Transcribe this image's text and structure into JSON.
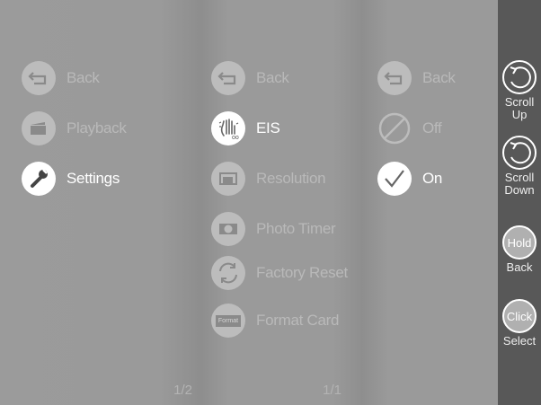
{
  "panel1": {
    "items": [
      {
        "label": "Back",
        "icon": "back-arrow-icon",
        "active": false
      },
      {
        "label": "Playback",
        "icon": "playback-icon",
        "active": false
      },
      {
        "label": "Settings",
        "icon": "wrench-icon",
        "active": true
      }
    ],
    "pager": "1/2"
  },
  "panel2": {
    "items": [
      {
        "label": "Back",
        "icon": "back-arrow-icon",
        "active": false
      },
      {
        "label": "EIS",
        "icon": "shaking-hand-icon",
        "active": true
      },
      {
        "label": "Resolution",
        "icon": "resolution-icon",
        "active": false
      },
      {
        "label": "Photo Timer",
        "icon": "photo-timer-icon",
        "active": false
      },
      {
        "label": "Factory Reset",
        "icon": "factory-reset-icon",
        "active": false
      },
      {
        "label": "Format Card",
        "icon": "format-card-icon",
        "icon_text": "Format",
        "active": false
      }
    ],
    "pager": "1/1"
  },
  "panel3": {
    "items": [
      {
        "label": "Back",
        "icon": "back-arrow-icon",
        "active": false
      },
      {
        "label": "Off",
        "icon": "prohibited-icon",
        "active": false
      },
      {
        "label": "On",
        "icon": "checkmark-icon",
        "active": true
      }
    ]
  },
  "rail": {
    "scroll_up": {
      "label": "Scroll Up",
      "icon": "rotate-arrow-icon"
    },
    "scroll_down": {
      "label": "Scroll Down",
      "icon": "rotate-arrow-icon"
    },
    "hold_back": {
      "circle": "Hold",
      "label": "Back"
    },
    "click_select": {
      "circle": "Click",
      "label": "Select"
    }
  },
  "colors": {
    "panel_bg": "#9a9a9a",
    "rail_bg": "#585858",
    "active_text": "#ffffff",
    "inactive_text": "#b9b9b9"
  }
}
